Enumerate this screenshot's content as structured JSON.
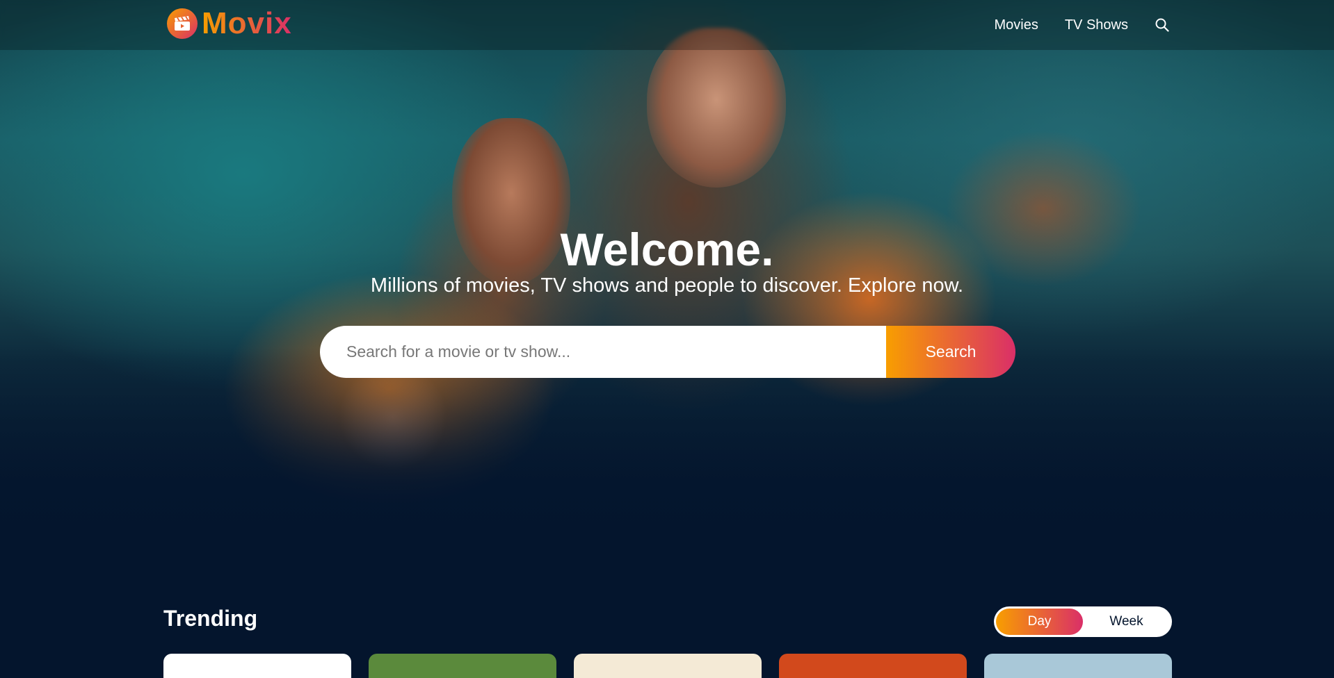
{
  "app": {
    "logo_text": "Movix"
  },
  "nav": {
    "items": [
      {
        "label": "Movies"
      },
      {
        "label": "TV Shows"
      }
    ],
    "search_icon": "search-icon"
  },
  "hero": {
    "title": "Welcome.",
    "subtitle": "Millions of movies, TV shows and people to discover. Explore now.",
    "search": {
      "placeholder": "Search for a movie or tv show...",
      "value": "",
      "button_label": "Search"
    }
  },
  "trending": {
    "title": "Trending",
    "tabs": [
      {
        "label": "Day",
        "active": true
      },
      {
        "label": "Week",
        "active": false
      }
    ],
    "cards": [
      {
        "color": "#ffffff"
      },
      {
        "color": "#5b8a3c"
      },
      {
        "color": "#f4ead6"
      },
      {
        "color": "#d2491c"
      },
      {
        "color": "#a9c8d8"
      }
    ]
  },
  "colors": {
    "background": "#04152d",
    "accent_start": "#f89e00",
    "accent_end": "#da2f68"
  }
}
